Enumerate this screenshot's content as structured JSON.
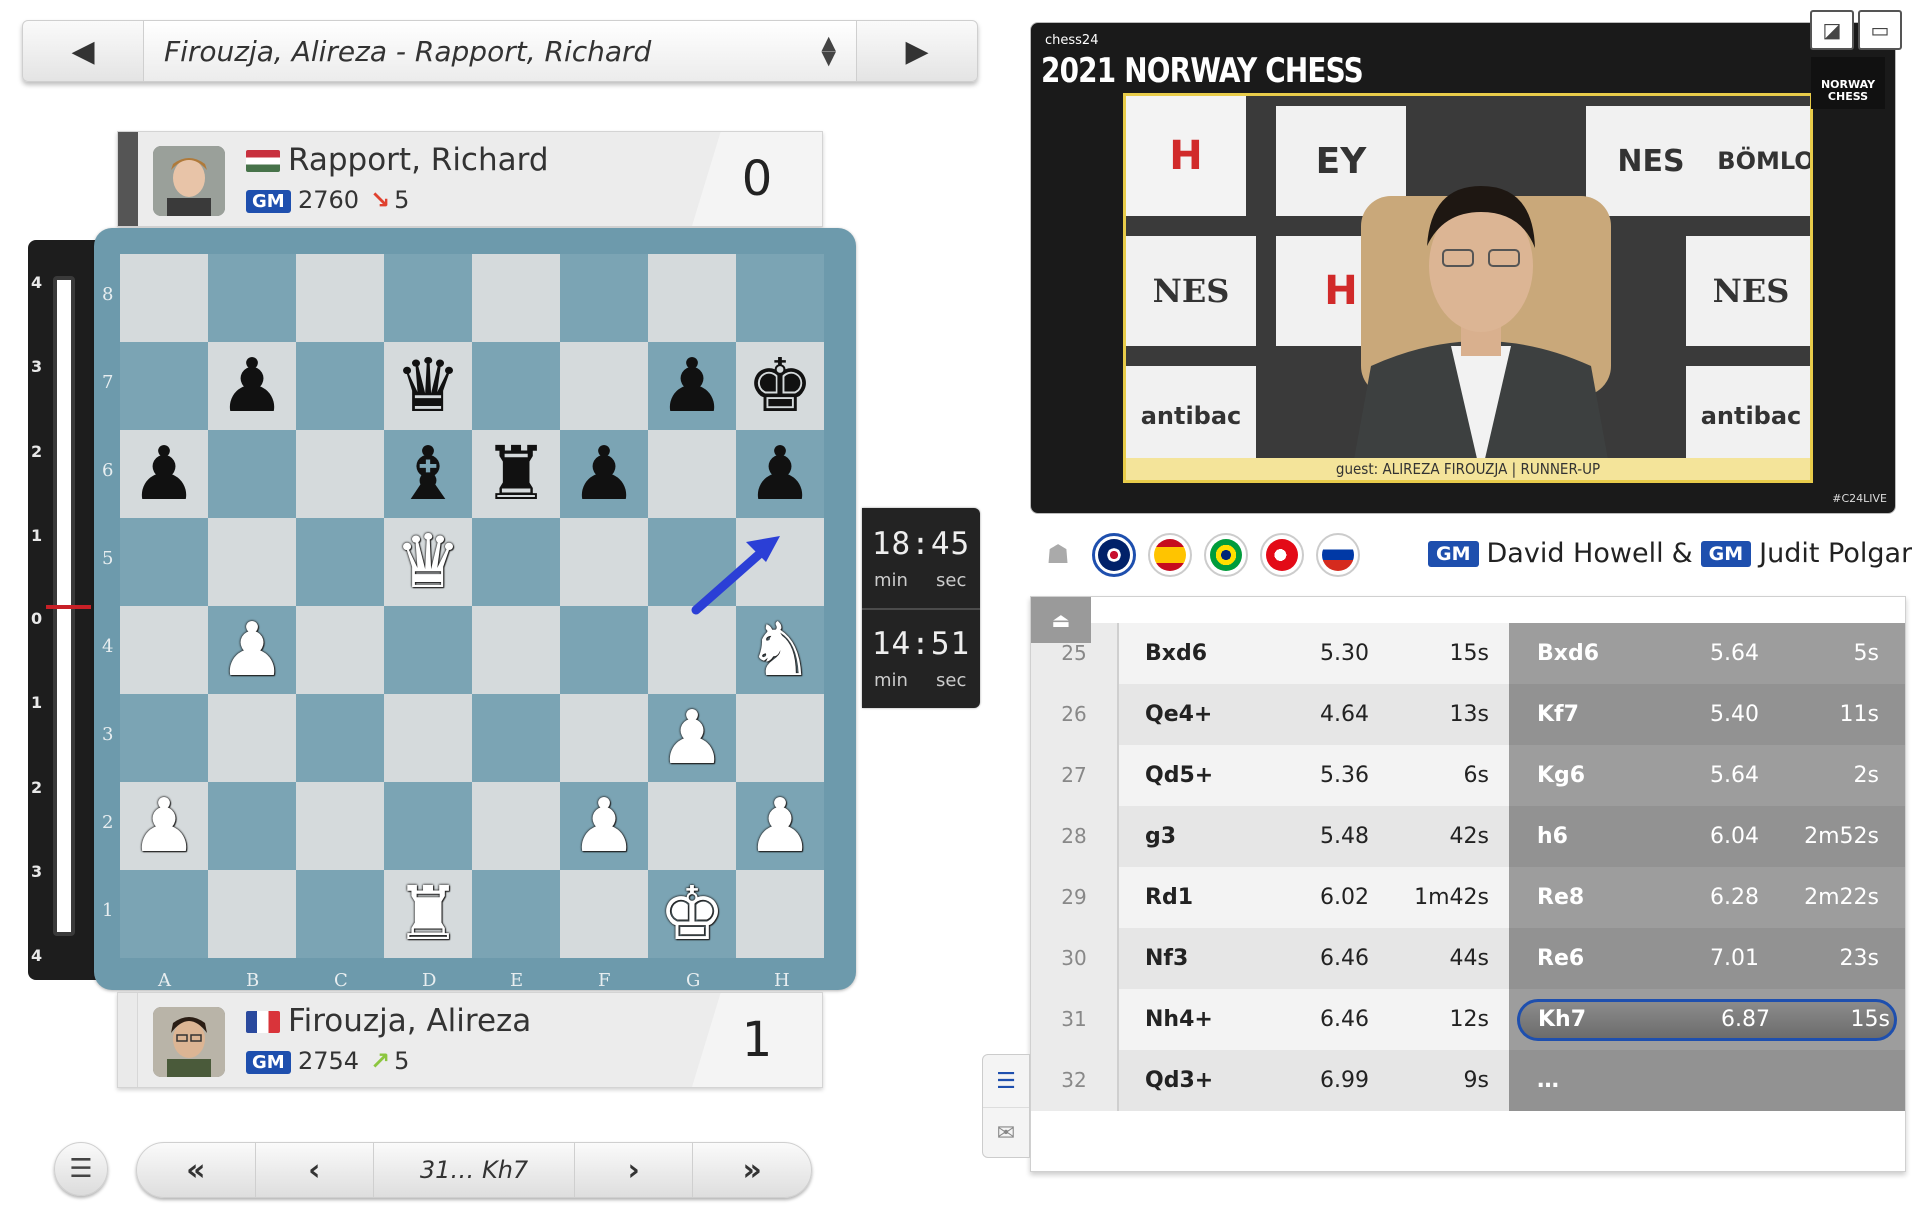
{
  "game_selector": {
    "prev_icon": "triangle-left",
    "title": "Firouzja, Alireza - Rapport, Richard",
    "next_icon": "triangle-right"
  },
  "top_player": {
    "name": "Rapport, Richard",
    "title": "GM",
    "rating": "2760",
    "rating_change": "5",
    "rating_direction": "down",
    "score": "0",
    "flag": "hungary"
  },
  "bottom_player": {
    "name": "Firouzja, Alireza",
    "title": "GM",
    "rating": "2754",
    "rating_change": "5",
    "rating_direction": "up",
    "score": "1",
    "flag": "france"
  },
  "eval_bar": {
    "ticks": [
      "4",
      "3",
      "2",
      "1",
      "0",
      "1",
      "2",
      "3",
      "4"
    ],
    "indicator_value": 0
  },
  "board": {
    "files": [
      "A",
      "B",
      "C",
      "D",
      "E",
      "F",
      "G",
      "H"
    ],
    "ranks": [
      "8",
      "7",
      "6",
      "5",
      "4",
      "3",
      "2",
      "1"
    ],
    "position": [
      [
        "",
        "",
        "",
        "",
        "",
        "",
        "",
        ""
      ],
      [
        "",
        "p",
        "",
        "q",
        "",
        "",
        "p",
        "k"
      ],
      [
        "p",
        "",
        "",
        "b",
        "r",
        "p",
        "",
        "p"
      ],
      [
        "",
        "",
        "",
        "Q",
        "",
        "",
        "",
        ""
      ],
      [
        "",
        "P",
        "",
        "",
        "",
        "",
        "",
        "N"
      ],
      [
        "",
        "",
        "",
        "",
        "",
        "",
        "P",
        ""
      ],
      [
        "P",
        "",
        "",
        "",
        "",
        "P",
        "",
        "P"
      ],
      [
        "",
        "",
        "",
        "R",
        "",
        "",
        "K",
        ""
      ]
    ],
    "last_move_arrow": {
      "from": "g6",
      "to": "h7",
      "color": "#2b3fd6"
    }
  },
  "clocks": {
    "top": {
      "time": "18:45",
      "min_label": "min",
      "sec_label": "sec"
    },
    "bottom": {
      "time": "14:51",
      "min_label": "min",
      "sec_label": "sec"
    }
  },
  "move_nav": {
    "first": "«",
    "prev": "‹",
    "current": "31… Kh7",
    "next": "›",
    "last": "»"
  },
  "video": {
    "brand": "chess24",
    "event_title": "2021 NORWAY CHESS",
    "caption": "guest: ALIREZA FIROUZJA | RUNNER-UP",
    "logo": "NORWAY CHESS",
    "social": "#C24LIVE"
  },
  "commentary": {
    "languages": [
      "english",
      "spanish",
      "portuguese",
      "turkish",
      "russian"
    ],
    "selected_language": "english",
    "commentators": [
      {
        "title": "GM",
        "name": "David Howell"
      },
      {
        "title": "GM",
        "name": "Judit Polgar"
      }
    ],
    "separator": "&"
  },
  "moves": [
    {
      "num": "25",
      "white": "Bxd6",
      "white_eval": "5.30",
      "white_time": "15s",
      "black": "Bxd6",
      "black_eval": "5.64",
      "black_time": "5s"
    },
    {
      "num": "26",
      "white": "Qe4+",
      "white_eval": "4.64",
      "white_time": "13s",
      "black": "Kf7",
      "black_eval": "5.40",
      "black_time": "11s"
    },
    {
      "num": "27",
      "white": "Qd5+",
      "white_eval": "5.36",
      "white_time": "6s",
      "black": "Kg6",
      "black_eval": "5.64",
      "black_time": "2s"
    },
    {
      "num": "28",
      "white": "g3",
      "white_eval": "5.48",
      "white_time": "42s",
      "black": "h6",
      "black_eval": "6.04",
      "black_time": "2m52s"
    },
    {
      "num": "29",
      "white": "Rd1",
      "white_eval": "6.02",
      "white_time": "1m42s",
      "black": "Re8",
      "black_eval": "6.28",
      "black_time": "2m22s"
    },
    {
      "num": "30",
      "white": "Nf3",
      "white_eval": "6.46",
      "white_time": "44s",
      "black": "Re6",
      "black_eval": "7.01",
      "black_time": "23s"
    },
    {
      "num": "31",
      "white": "Nh4+",
      "white_eval": "6.46",
      "white_time": "12s",
      "black": "Kh7",
      "black_eval": "6.87",
      "black_time": "15s",
      "selected": true
    },
    {
      "num": "32",
      "white": "Qd3+",
      "white_eval": "6.99",
      "white_time": "9s",
      "black": "…",
      "black_eval": "",
      "black_time": ""
    }
  ],
  "colors": {
    "accent": "#1e4fae",
    "board_light": "#d5dadc",
    "board_dark": "#7ba4b4",
    "frame": "#6d9aac",
    "eval_marker": "#c82027"
  }
}
